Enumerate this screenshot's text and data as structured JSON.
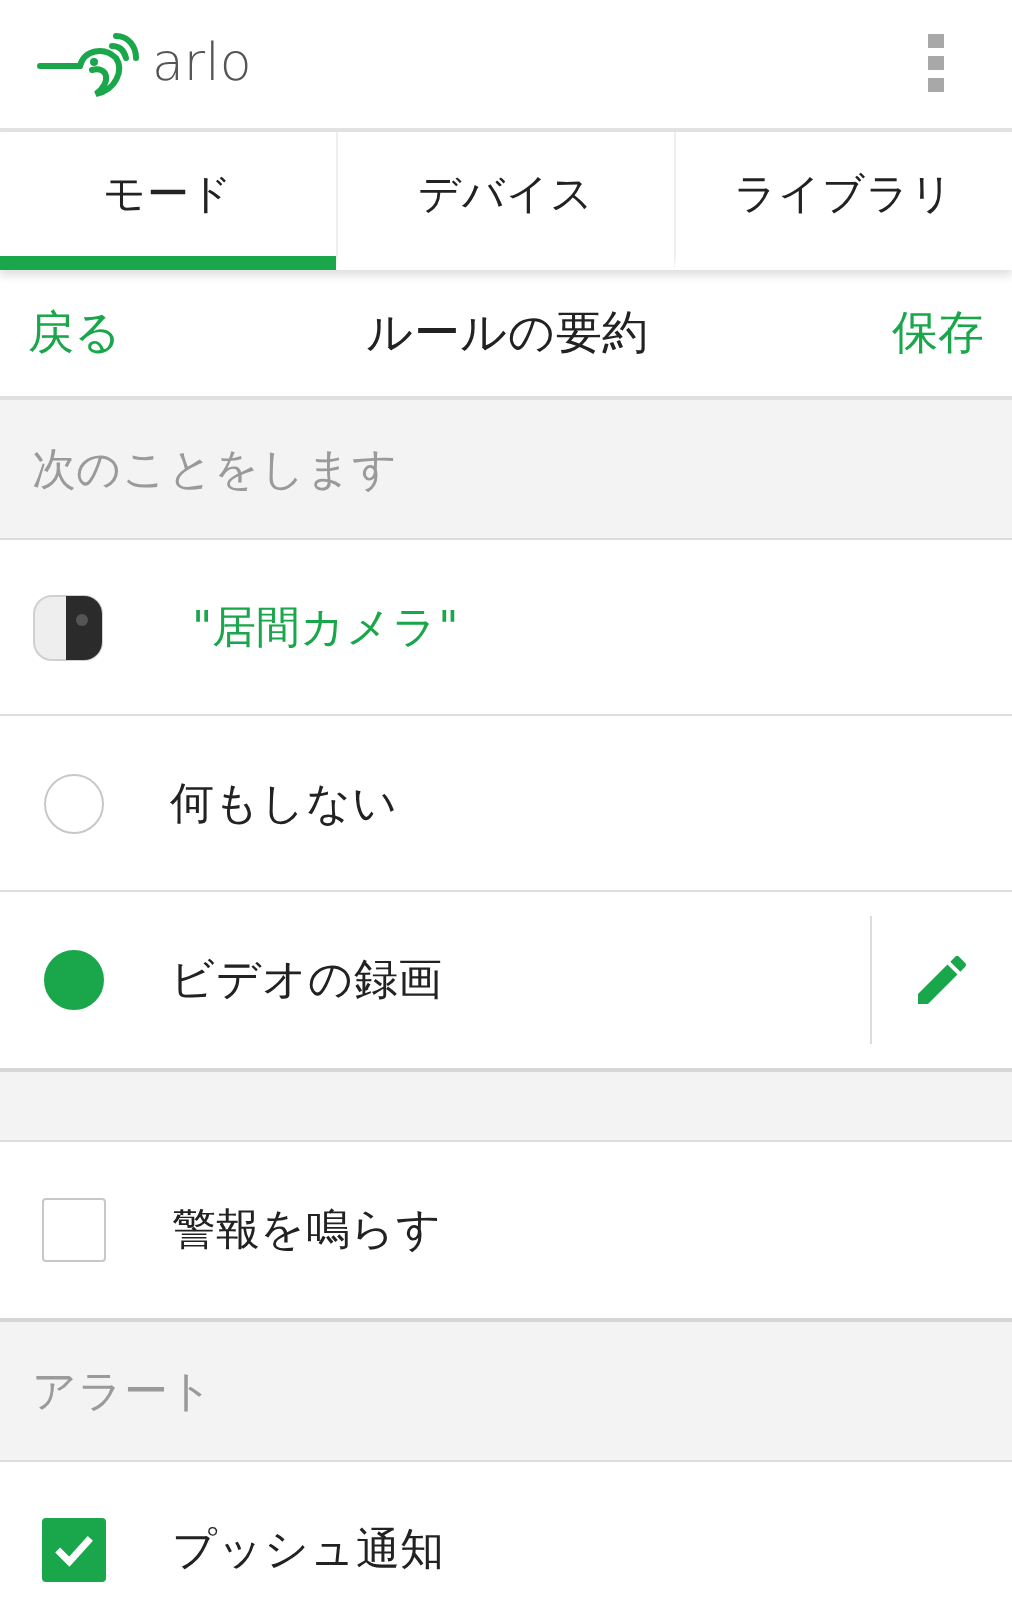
{
  "header": {
    "logo": "arlo"
  },
  "tabs": [
    {
      "label": "モード",
      "selected": true
    },
    {
      "label": "デバイス",
      "selected": false
    },
    {
      "label": "ライブラリ",
      "selected": false
    }
  ],
  "nav": {
    "back": "戻る",
    "title": "ルールの要約",
    "save": "保存"
  },
  "sections": [
    {
      "heading": "次のことをします",
      "rows": [
        {
          "kind": "device",
          "label": "\"居間カメラ\""
        },
        {
          "kind": "radio",
          "label": "何もしない",
          "selected": false
        },
        {
          "kind": "radio",
          "label": "ビデオの録画",
          "selected": true,
          "editable": true
        }
      ]
    },
    {
      "rows": [
        {
          "kind": "checkbox",
          "label": "警報を鳴らす",
          "checked": false
        }
      ]
    },
    {
      "heading": "アラート",
      "rows": [
        {
          "kind": "checkbox",
          "label": "プッシュ通知",
          "checked": true
        }
      ]
    }
  ]
}
